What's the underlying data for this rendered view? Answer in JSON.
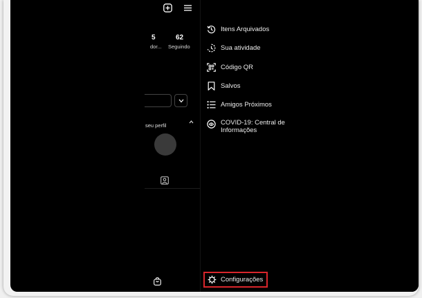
{
  "profile": {
    "stats": [
      {
        "value": "5",
        "label": "dor..."
      },
      {
        "value": "62",
        "label": "Seguindo"
      }
    ],
    "section_text": "seu perfil"
  },
  "drawer": {
    "items": [
      {
        "label": "Itens Arquivados",
        "icon": "archive-clock-icon"
      },
      {
        "label": "Sua atividade",
        "icon": "activity-icon"
      },
      {
        "label": "Código QR",
        "icon": "qr-code-icon"
      },
      {
        "label": "Salvos",
        "icon": "bookmark-icon"
      },
      {
        "label": "Amigos Próximos",
        "icon": "close-friends-list-icon"
      },
      {
        "label": "COVID-19: Central de",
        "label2": "Informações",
        "icon": "covid-info-icon"
      }
    ],
    "settings_label": "Configurações",
    "settings_icon": "gear-icon",
    "highlight_color": "#d9262c"
  }
}
